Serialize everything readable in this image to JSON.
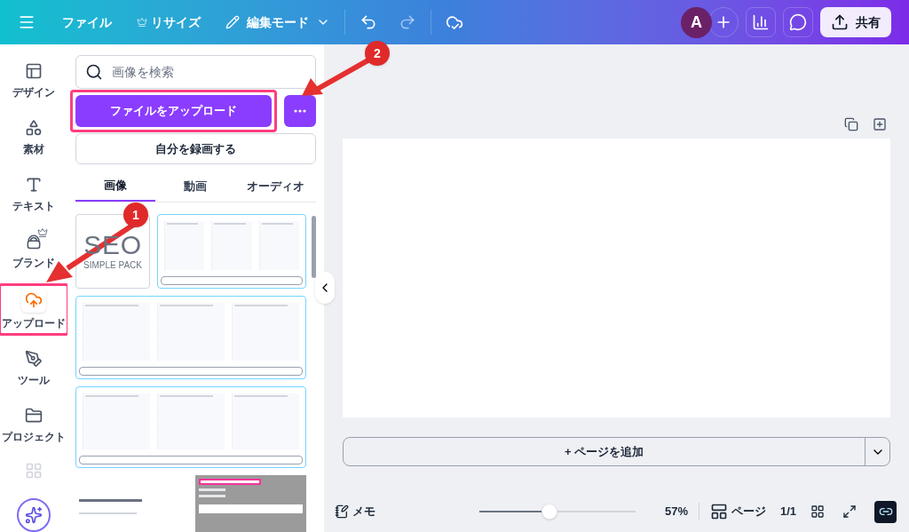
{
  "topbar": {
    "menu_items": [
      {
        "label": "ファイル",
        "premium": false
      },
      {
        "label": "リサイズ",
        "premium": true
      }
    ],
    "edit_mode": "編集モード",
    "avatar": "A",
    "share": "共有"
  },
  "sidebar": {
    "items": [
      {
        "label": "デザイン",
        "selected": false,
        "premium": false,
        "highlighted": false
      },
      {
        "label": "素材",
        "selected": false,
        "premium": false,
        "highlighted": false
      },
      {
        "label": "テキスト",
        "selected": false,
        "premium": false,
        "highlighted": false
      },
      {
        "label": "ブランド",
        "selected": false,
        "premium": true,
        "highlighted": false
      },
      {
        "label": "アップロード",
        "selected": true,
        "premium": false,
        "highlighted": true
      },
      {
        "label": "ツール",
        "selected": false,
        "premium": false,
        "highlighted": false
      },
      {
        "label": "プロジェクト",
        "selected": false,
        "premium": false,
        "highlighted": false
      }
    ]
  },
  "panel": {
    "search": {
      "placeholder": "画像を検索"
    },
    "upload_button": "ファイルをアップロード",
    "upload_highlighted": true,
    "record_button": "自分を録画する",
    "tabs": [
      {
        "label": "画像",
        "selected": true
      },
      {
        "label": "動画",
        "selected": false
      },
      {
        "label": "オーディオ",
        "selected": false
      }
    ],
    "thumbnails": [
      {
        "kind": "logo",
        "title": "SEO",
        "subtitle": "SIMPLE PACK"
      },
      {
        "kind": "layout"
      },
      {
        "kind": "layout"
      },
      {
        "kind": "layout"
      },
      {
        "kind": "article"
      },
      {
        "kind": "screenshot"
      }
    ]
  },
  "canvas": {
    "add_page": "+ ページを追加"
  },
  "bottom_bar": {
    "notes": "メモ",
    "zoom": {
      "level": 0.45
    },
    "zoom_reading": "57%",
    "pages": "ページ",
    "page_count": "1/1"
  },
  "annotations": [
    {
      "number": "1"
    },
    {
      "number": "2"
    }
  ]
}
